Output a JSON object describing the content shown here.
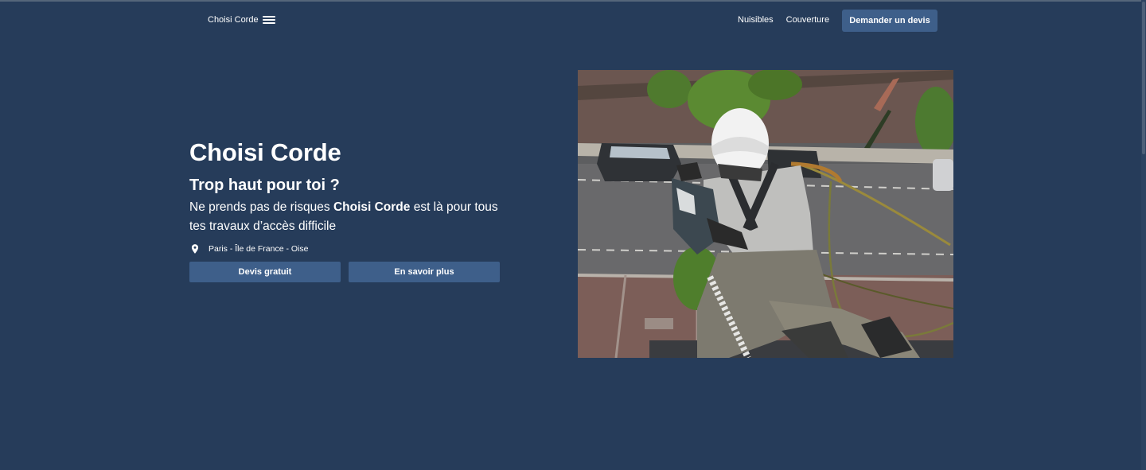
{
  "nav": {
    "brand": "Choisi Corde",
    "links": [
      "Nuisibles",
      "Couverture"
    ],
    "cta_label": "Demander un devis"
  },
  "hero": {
    "title": "Choisi Corde",
    "subtitle": "Trop haut pour toi ?",
    "text_before": "Ne prends pas de risques ",
    "text_strong": "Choisi Corde",
    "text_after": " est là pour tous tes travaux d’accès difficile",
    "location": "Paris - Île de France - Oise",
    "primary_button": "Devis gratuit",
    "secondary_button": "En savoir plus"
  },
  "icons": {
    "menu": "hamburger-icon",
    "location": "map-pin-icon"
  },
  "colors": {
    "background": "#263c5a",
    "button": "#3e5f8a",
    "text": "#ffffff"
  }
}
